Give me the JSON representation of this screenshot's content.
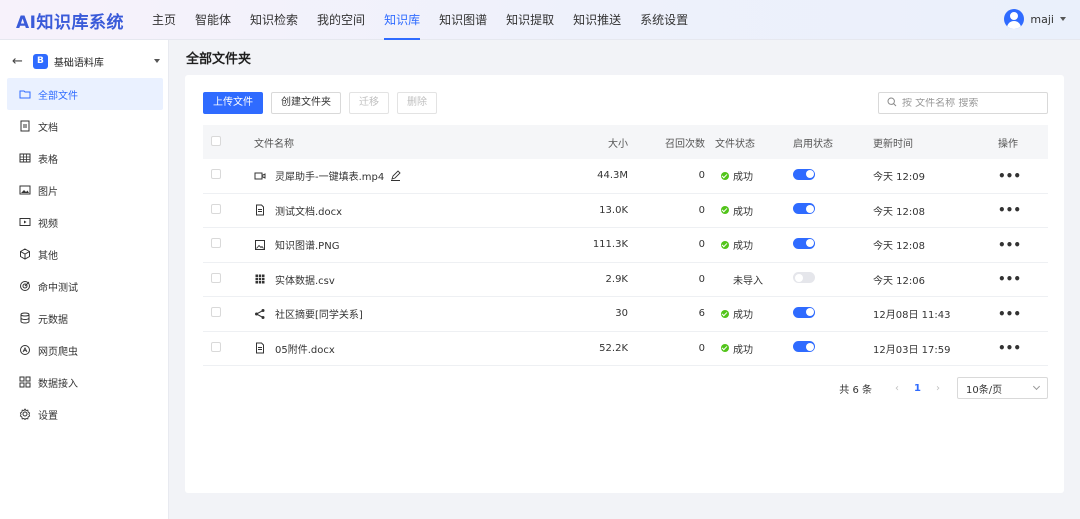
{
  "app": {
    "logo": "AI知识库系统"
  },
  "nav": {
    "items": [
      {
        "label": "主页"
      },
      {
        "label": "智能体"
      },
      {
        "label": "知识检索"
      },
      {
        "label": "我的空间"
      },
      {
        "label": "知识库",
        "active": true
      },
      {
        "label": "知识图谱"
      },
      {
        "label": "知识提取"
      },
      {
        "label": "知识推送"
      },
      {
        "label": "系统设置"
      }
    ],
    "user": "maji"
  },
  "sidebar": {
    "library_badge": "B",
    "library_name": "基础语料库",
    "items": [
      {
        "label": "全部文件",
        "icon": "folder-icon",
        "active": true
      },
      {
        "label": "文档",
        "icon": "document-icon"
      },
      {
        "label": "表格",
        "icon": "table-icon"
      },
      {
        "label": "图片",
        "icon": "image-icon"
      },
      {
        "label": "视频",
        "icon": "video-icon"
      },
      {
        "label": "其他",
        "icon": "cube-icon"
      },
      {
        "label": "命中测试",
        "icon": "target-icon"
      },
      {
        "label": "元数据",
        "icon": "database-icon"
      },
      {
        "label": "网页爬虫",
        "icon": "crawler-icon"
      },
      {
        "label": "数据接入",
        "icon": "grid-icon"
      },
      {
        "label": "设置",
        "icon": "gear-icon"
      }
    ]
  },
  "page": {
    "title": "全部文件夹"
  },
  "toolbar": {
    "upload": "上传文件",
    "create_folder": "创建文件夹",
    "move": "迁移",
    "delete": "删除"
  },
  "search": {
    "placeholder": "按 文件名称 搜索"
  },
  "table": {
    "headers": {
      "name": "文件名称",
      "size": "大小",
      "recall": "召回次数",
      "status": "文件状态",
      "enabled": "启用状态",
      "updated": "更新时间",
      "ops": "操作"
    },
    "rows": [
      {
        "icon": "video-file-icon",
        "name": "灵犀助手-一键填表.mp4",
        "size": "44.3M",
        "recall": "0",
        "status": "成功",
        "status_ok": true,
        "enabled": true,
        "updated": "今天 12:09",
        "editable": true
      },
      {
        "icon": "document-file-icon",
        "name": "测试文档.docx",
        "size": "13.0K",
        "recall": "0",
        "status": "成功",
        "status_ok": true,
        "enabled": true,
        "updated": "今天 12:08"
      },
      {
        "icon": "image-file-icon",
        "name": "知识图谱.PNG",
        "size": "111.3K",
        "recall": "0",
        "status": "成功",
        "status_ok": true,
        "enabled": true,
        "updated": "今天 12:08"
      },
      {
        "icon": "spreadsheet-file-icon",
        "name": "实体数据.csv",
        "size": "2.9K",
        "recall": "0",
        "status": "未导入",
        "status_ok": false,
        "enabled": false,
        "updated": "今天 12:06"
      },
      {
        "icon": "graph-file-icon",
        "name": "社区摘要[同学关系]",
        "size": "30",
        "recall": "6",
        "status": "成功",
        "status_ok": true,
        "enabled": true,
        "updated": "12月08日 11:43"
      },
      {
        "icon": "document-file-icon",
        "name": "05附件.docx",
        "size": "52.2K",
        "recall": "0",
        "status": "成功",
        "status_ok": true,
        "enabled": true,
        "updated": "12月03日 17:59"
      }
    ],
    "more_label": "•••"
  },
  "pagination": {
    "total": "共 6 条",
    "prev": "‹",
    "current": "1",
    "next": "›",
    "page_size": "10条/页"
  },
  "colors": {
    "primary": "#2f6bff",
    "success": "#52c41a"
  }
}
